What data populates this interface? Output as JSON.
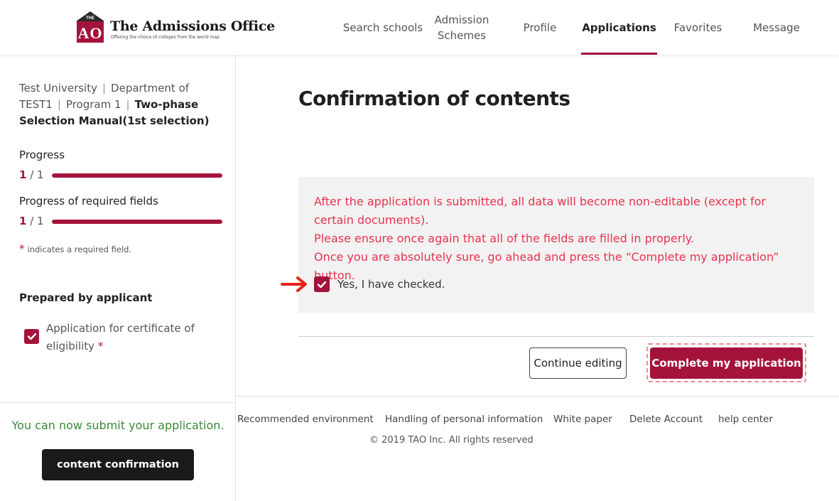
{
  "header": {
    "logo_mark_top": "THE",
    "logo_mark_letters": "AO",
    "logo_title": "The Admissions Office",
    "logo_subtitle": "Offering the choice of colleges from the world map",
    "nav": [
      {
        "label": "Search schools"
      },
      {
        "label": "Admission\nSchemes"
      },
      {
        "label": "Profile"
      },
      {
        "label": "Applications",
        "active": true
      },
      {
        "label": "Favorites"
      },
      {
        "label": "Message"
      }
    ]
  },
  "sidebar": {
    "breadcrumb": {
      "university": "Test University",
      "department": "Department of TEST1",
      "program": "Program 1",
      "selection": "Two-phase Selection Manual(1st selection)"
    },
    "progress": {
      "label": "Progress",
      "current": "1",
      "total": "/ 1",
      "fraction": 1.0
    },
    "required_progress": {
      "label": "Progress of required fields",
      "current": "1",
      "total": "/ 1",
      "fraction": 1.0
    },
    "required_note_star": "*",
    "required_note": "indicates a required field.",
    "prepared_heading": "Prepared by applicant",
    "prepared_items": [
      {
        "label": "Application for certificate of eligibility",
        "required_star": "*",
        "checked": true
      }
    ],
    "submit_message": "You can now submit your application.",
    "content_button": "content confirmation"
  },
  "main": {
    "title": "Confirmation of contents",
    "notice_lines": [
      "After the application is submitted, all data will become non-editable (except for certain documents).",
      "Please ensure once again that all of the fields are filled in properly.",
      "Once you are absolutely sure, go ahead and press the “Complete my application” button."
    ],
    "checkbox_label": "Yes, I have checked.",
    "checkbox_checked": true,
    "continue_button": "Continue editing",
    "complete_button": "Complete my application"
  },
  "footer": {
    "links": [
      "Recommended environment",
      "Handling of personal information",
      "White paper",
      "Delete Account",
      "help center"
    ],
    "copyright": "© 2019 TAO Inc. All rights reserved"
  },
  "colors": {
    "accent": "#a4133c",
    "notice_text": "#e8334f",
    "success_text": "#3a8a3a",
    "arrow": "#e8231c"
  }
}
